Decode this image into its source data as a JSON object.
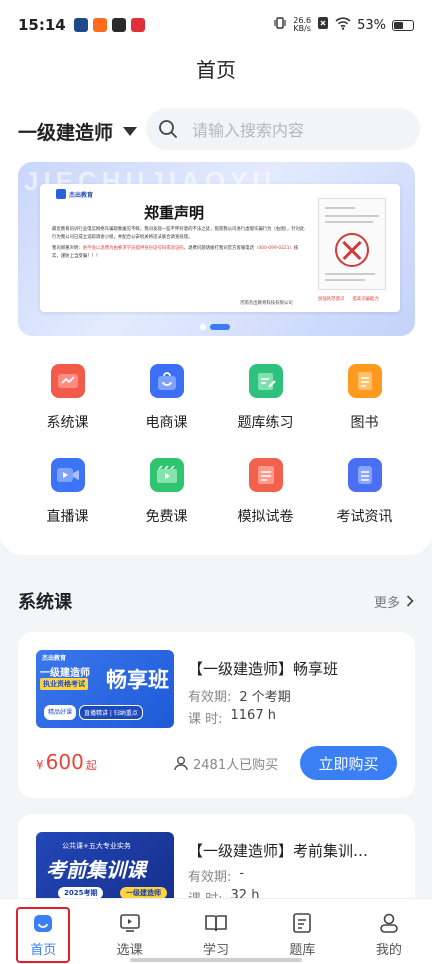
{
  "status_bar": {
    "time": "15:14",
    "net_speed": "26.6",
    "net_unit": "KB/s",
    "battery": "53%",
    "battery_level": 0.53
  },
  "page": {
    "title": "首页"
  },
  "exam": {
    "selected": "一级建造师"
  },
  "search": {
    "placeholder": "请输入搜索内容"
  },
  "banner": {
    "watermark": "JIECHUJIAOYU",
    "logo": "杰出教育",
    "title": "郑重声明",
    "paragraph1": "最近教育培训行业电信网络诈骗现象屡见不鲜，我司发现一些不怀好意的不法之徒，假冒我公司进行虚假诈骗行为（右图），针对此行为我公司已成立追踪调查小组，并配合公安机关将违法联合调查处理。",
    "para2_prefix": "我司郑重声明：",
    "para2_red": "绝不会以退费为由要求学员提供身份证号码或验证码",
    "para2_mid": "，退费问题请拨打我司官方客服电话",
    "para2_red2": "（400-099-0221）",
    "para2_end": "核实，谨防上当受骗！！！",
    "signature": "河南杰出教育科技有限公司",
    "foot_left": "加强防范意识",
    "foot_right": "提高识骗能力",
    "active_slide": 2,
    "slides": 2
  },
  "categories": [
    {
      "label": "系统课",
      "icon": "chart-icon",
      "color": "#f25a4a"
    },
    {
      "label": "电商课",
      "icon": "shopping-bag-icon",
      "color": "#3d6ff5"
    },
    {
      "label": "题库练习",
      "icon": "edit-doc-icon",
      "color": "#2ec27e"
    },
    {
      "label": "图书",
      "icon": "book-icon",
      "color": "#ff9a1f"
    },
    {
      "label": "直播课",
      "icon": "video-camera-icon",
      "color": "#3d74f5"
    },
    {
      "label": "免费课",
      "icon": "play-board-icon",
      "color": "#2fc56f"
    },
    {
      "label": "模拟试卷",
      "icon": "exam-paper-icon",
      "color": "#f2604e"
    },
    {
      "label": "考试资讯",
      "icon": "news-icon",
      "color": "#4a6ff2"
    }
  ],
  "section": {
    "title": "系统课",
    "more": "更多"
  },
  "courses": [
    {
      "title": "【一级建造师】畅享班",
      "validity_label": "有效期:",
      "validity": "2 个考期",
      "hours_label": "课 时:",
      "hours": "1167 h",
      "price_symbol": "¥",
      "price": "600",
      "price_suffix": "起",
      "buyers": "2481人已购买",
      "buy_label": "立即购买",
      "image": {
        "logo": "杰出教育",
        "tag": "一级建造师",
        "sub": "执业资格考试",
        "big": "畅享班",
        "badge1": "精品好课",
        "badge2": "直播精讲 | 归纳重点"
      }
    },
    {
      "title": "【一级建造师】考前集训…",
      "validity_label": "有效期:",
      "validity": "-",
      "hours_label": "课 时:",
      "hours": "32 h",
      "image": {
        "top": "公共课+五大专业实务",
        "big": "考前集训课",
        "pill1": "2025考期",
        "pill2": "一级建造师"
      }
    }
  ],
  "tabbar": [
    {
      "label": "首页",
      "icon": "home-icon",
      "active": true
    },
    {
      "label": "选课",
      "icon": "tv-icon",
      "active": false
    },
    {
      "label": "学习",
      "icon": "open-book-icon",
      "active": false
    },
    {
      "label": "题库",
      "icon": "question-bank-icon",
      "active": false
    },
    {
      "label": "我的",
      "icon": "profile-icon",
      "active": false
    }
  ]
}
